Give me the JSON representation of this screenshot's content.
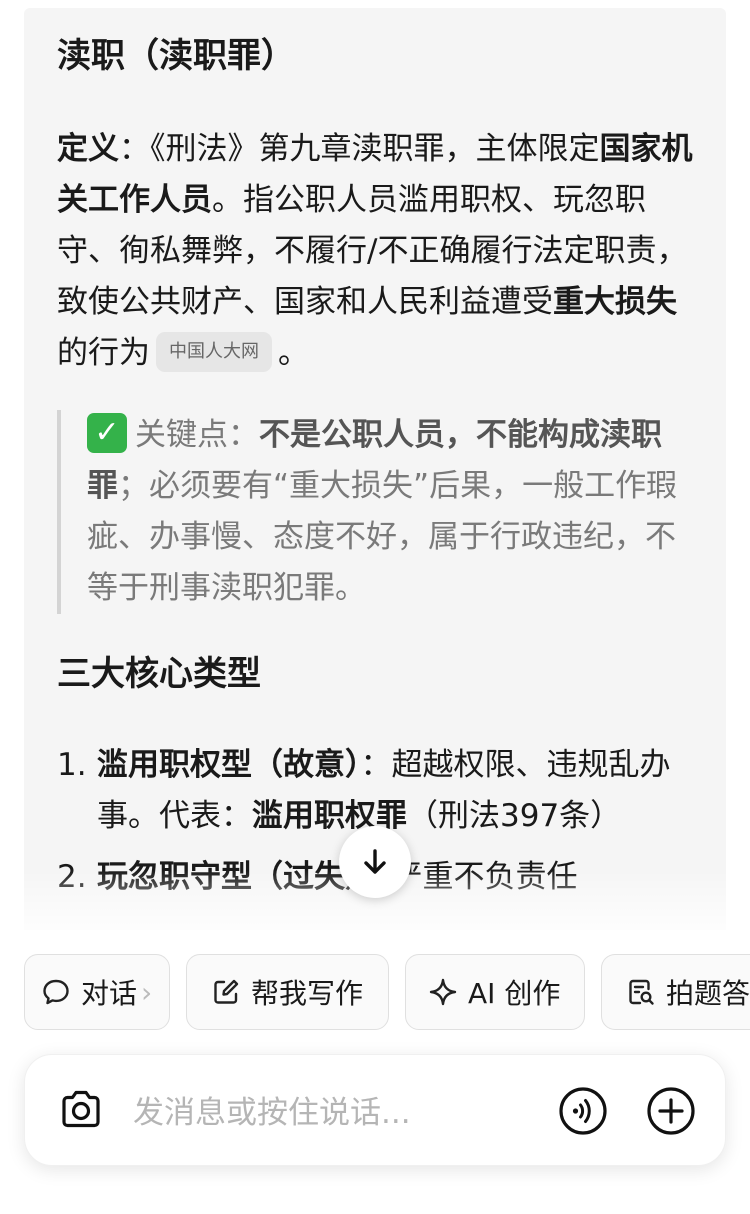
{
  "section1": {
    "title": "渎职（渎职罪）",
    "definition_label": "定义",
    "definition_text_1": "：《刑法》第九章渎职罪，主体限定",
    "definition_bold_1": "国家机关工作人员",
    "definition_text_2": "。指公职人员滥用职权、玩忽职守、徇私舞弊，不履行/不正确履行法定职责，致使公共财产、国家和人民利益遭受",
    "definition_bold_2": "重大损失",
    "definition_text_3": "的行为",
    "source_chip": "中国人大网",
    "definition_end": "。"
  },
  "keypoint": {
    "icon": "check-mark-icon",
    "label": "关键点：",
    "bold": "不是公职人员，不能构成渎职罪",
    "text": "；必须要有“重大损失”后果，一般工作瑕疵、办事慢、态度不好，属于行政违纪，不等于刑事渎职犯罪。"
  },
  "section2": {
    "title": "三大核心类型",
    "items": [
      {
        "num": "1.",
        "bold": "滥用职权型（故意）",
        "text": "：超越权限、违规乱办事。代表：",
        "bold2": "滥用职权罪",
        "text2": "（刑法397条）"
      },
      {
        "num": "2.",
        "bold": "玩忽职守型（过失）",
        "text": "：严重不负责任"
      }
    ]
  },
  "chips": [
    {
      "label": "对话",
      "icon": "chat-bubble-icon"
    },
    {
      "label": "帮我写作",
      "icon": "edit-icon"
    },
    {
      "label": "AI 创作",
      "icon": "sparkle-icon"
    },
    {
      "label": "拍题答",
      "icon": "doc-search-icon"
    }
  ],
  "input": {
    "placeholder": "发消息或按住说话..."
  },
  "colors": {
    "card_bg": "#f5f5f5",
    "check_green": "#34b24a",
    "quote_text": "#7a7a7a"
  }
}
